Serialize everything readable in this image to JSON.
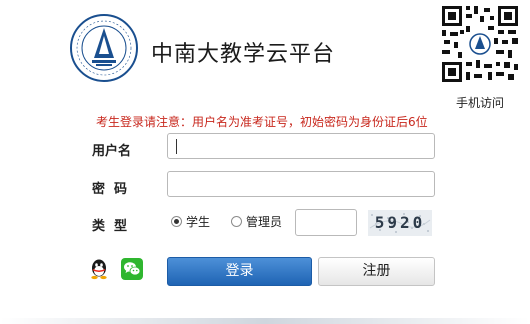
{
  "header": {
    "title": "中南大教学云平台",
    "logo": {
      "icon": "university-seal-icon",
      "color": "#1a4f8f"
    },
    "qr": {
      "icon": "qr-code-icon",
      "caption": "手机访问"
    }
  },
  "notice": "考生登录请注意：用户名为准考证号，初始密码为身份证后6位",
  "form": {
    "username": {
      "label": "用户名",
      "value": "",
      "placeholder": ""
    },
    "password": {
      "label": "密  码",
      "value": "",
      "placeholder": ""
    },
    "type": {
      "label": "类  型",
      "options": [
        {
          "label": "学生",
          "selected": true
        },
        {
          "label": "管理员",
          "selected": false
        }
      ]
    },
    "captcha": {
      "input_value": "",
      "code": "5920"
    }
  },
  "social": [
    {
      "name": "QQ",
      "icon": "qq-icon"
    },
    {
      "name": "WeChat",
      "icon": "wechat-icon"
    }
  ],
  "buttons": {
    "login": "登录",
    "register": "注册"
  },
  "colors": {
    "notice": "#c8281e",
    "login_button": "#2a6fc0",
    "register_button": "#eeeeee",
    "wechat": "#2fb62f"
  }
}
